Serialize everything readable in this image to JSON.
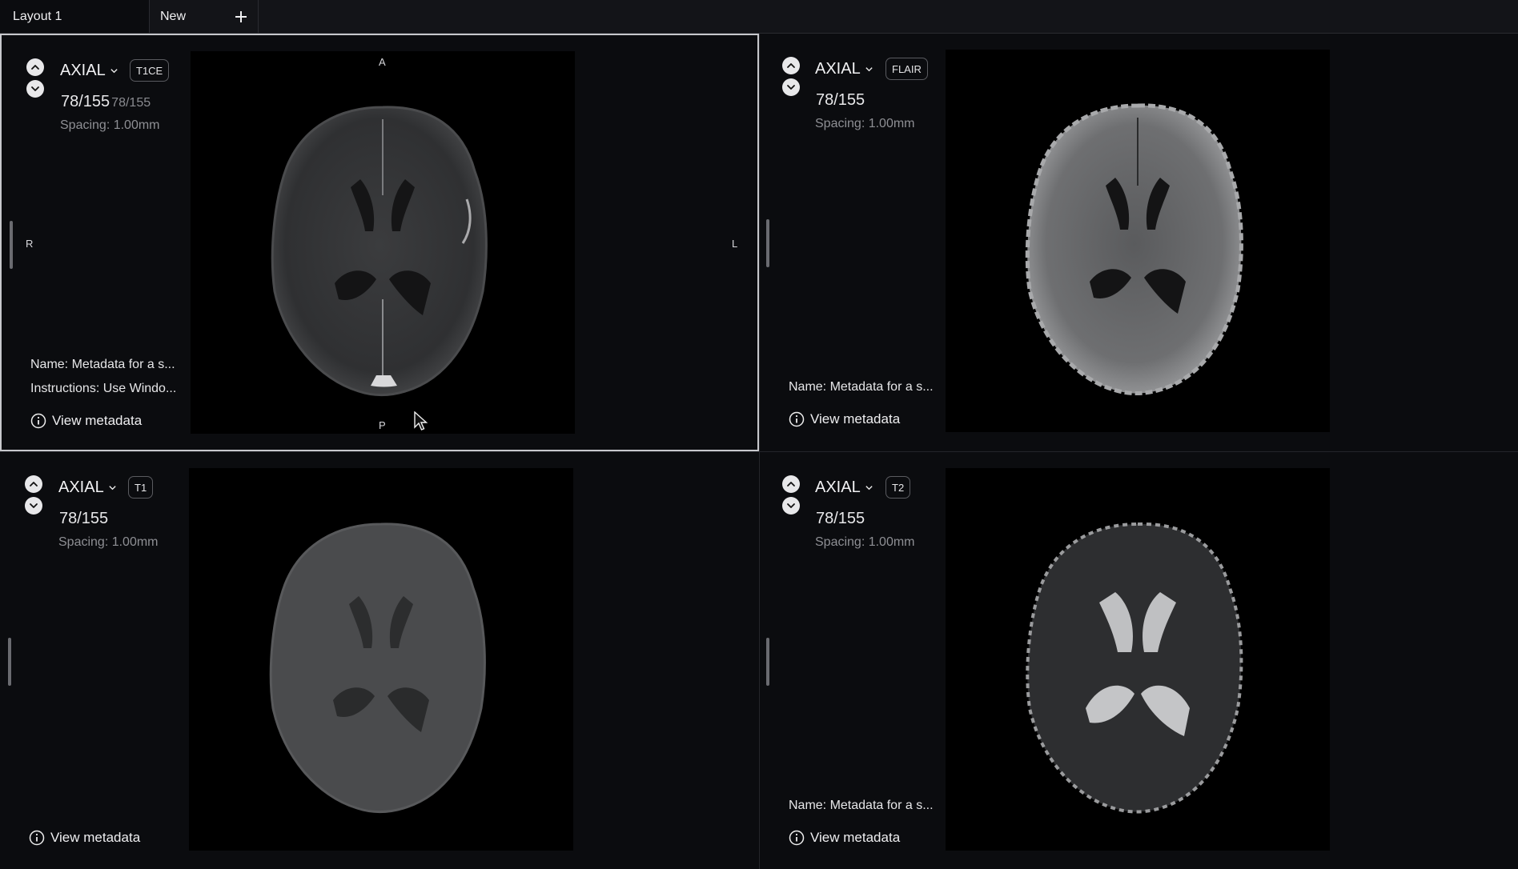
{
  "tabs": [
    {
      "label": "Layout 1"
    },
    {
      "label": "New"
    }
  ],
  "add_tab_icon": "plus-icon",
  "panes": {
    "top_left": {
      "plane": "AXIAL",
      "series": "T1CE",
      "slice": "78/155",
      "slice_ghost": "78/155",
      "spacing": "Spacing: 1.00mm",
      "orientation": {
        "top": "A",
        "bottom": "P",
        "left": "R",
        "right": "L"
      },
      "name": "Name: Metadata for a s...",
      "instructions": "Instructions: Use Windo...",
      "view_metadata": "View metadata"
    },
    "top_right": {
      "plane": "AXIAL",
      "series": "FLAIR",
      "slice": "78/155",
      "spacing": "Spacing: 1.00mm",
      "name": "Name: Metadata for a s...",
      "view_metadata": "View metadata"
    },
    "bottom_left": {
      "plane": "AXIAL",
      "series": "T1",
      "slice": "78/155",
      "spacing": "Spacing: 1.00mm",
      "view_metadata": "View metadata"
    },
    "bottom_right": {
      "plane": "AXIAL",
      "series": "T2",
      "slice": "78/155",
      "spacing": "Spacing: 1.00mm",
      "name": "Name: Metadata for a s...",
      "view_metadata": "View metadata"
    }
  },
  "colors": {
    "background": "#0b0c0f",
    "active_border": "#c7c8cc",
    "muted_text": "#8e8f94"
  }
}
